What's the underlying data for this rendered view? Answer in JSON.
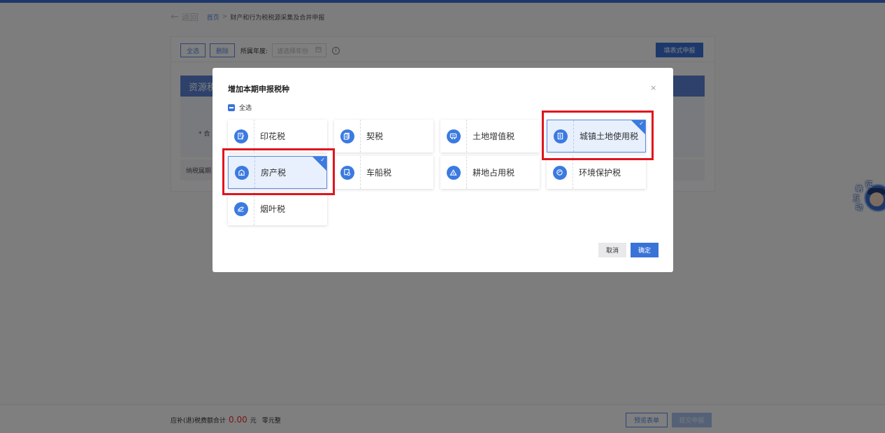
{
  "page": {
    "back_label": "返回",
    "breadcrumb_home": "首页",
    "breadcrumb_sep": ">",
    "breadcrumb_current": "财产和行为税税源采集及合并申报",
    "select_all_button": "全选",
    "delete_button": "删除",
    "year_label": "所属年度:",
    "year_placeholder": "请选择年份",
    "fill_declare_button": "填表式申报",
    "resource_tax_header": "资源税",
    "he_label": "* 合",
    "tax_period_label": "纳税属期"
  },
  "footer": {
    "total_label": "应补(退)税费额合计",
    "amount": "0.00",
    "unit": "元",
    "amount_words": "零元整",
    "preview_button": "预览表单",
    "submit_button": "提交申报"
  },
  "mascot": {
    "chars": [
      "纳",
      "征",
      "互",
      "动"
    ]
  },
  "modal": {
    "title": "增加本期申报税种",
    "close": "×",
    "select_all_label": "全选",
    "cancel_button": "取消",
    "confirm_button": "确定",
    "tax_types": [
      {
        "label": "印花税",
        "selected": false,
        "icon": "document-edit-icon"
      },
      {
        "label": "契税",
        "selected": false,
        "icon": "files-icon"
      },
      {
        "label": "土地增值税",
        "selected": false,
        "icon": "land-appreciation-icon"
      },
      {
        "label": "城镇土地使用税",
        "selected": true,
        "icon": "building-doc-icon"
      },
      {
        "label": "房产税",
        "selected": true,
        "icon": "house-icon"
      },
      {
        "label": "车船税",
        "selected": false,
        "icon": "vehicle-icon"
      },
      {
        "label": "耕地占用税",
        "selected": false,
        "icon": "farmland-icon"
      },
      {
        "label": "环境保护税",
        "selected": false,
        "icon": "environment-icon"
      },
      {
        "label": "烟叶税",
        "selected": false,
        "icon": "tobacco-leaf-icon"
      }
    ]
  },
  "colors": {
    "primary": "#3a73d8",
    "highlight_red": "#e0141e",
    "amount_red": "#e33333"
  }
}
